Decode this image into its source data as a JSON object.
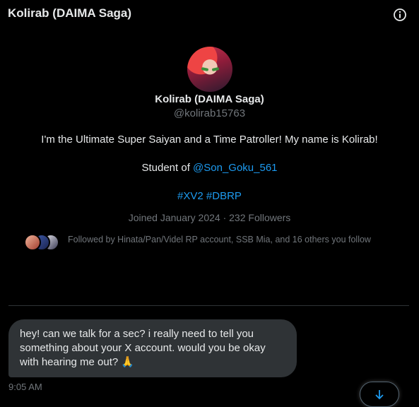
{
  "header": {
    "title": "Kolirab (DAIMA Saga)",
    "info_icon": "info-icon"
  },
  "profile": {
    "display_name": "Kolirab (DAIMA Saga)",
    "handle": "@kolirab15763",
    "bio_line1": "I'm the Ultimate Super Saiyan and a Time Patroller! My name is Kolirab!",
    "bio_student_prefix": "Student of ",
    "bio_student_link": "@Son_Goku_561",
    "hashtag1": "#XV2",
    "hashtag2": "#DBRP",
    "joined": "Joined January 2024",
    "separator": " · ",
    "followers": "232 Followers",
    "followed_by": "Followed by Hinata/Pan/Videl RP account, SSB Mia, and 16 others you follow"
  },
  "message": {
    "text": "hey! can we talk for a sec? i really need to tell you something about your X account. would you be okay with hearing me out? 🙏",
    "time": "9:05 AM"
  },
  "colors": {
    "background": "#000000",
    "text": "#e7e9ea",
    "muted": "#71767b",
    "link": "#1d9bf0",
    "bubble": "#2f3336"
  }
}
